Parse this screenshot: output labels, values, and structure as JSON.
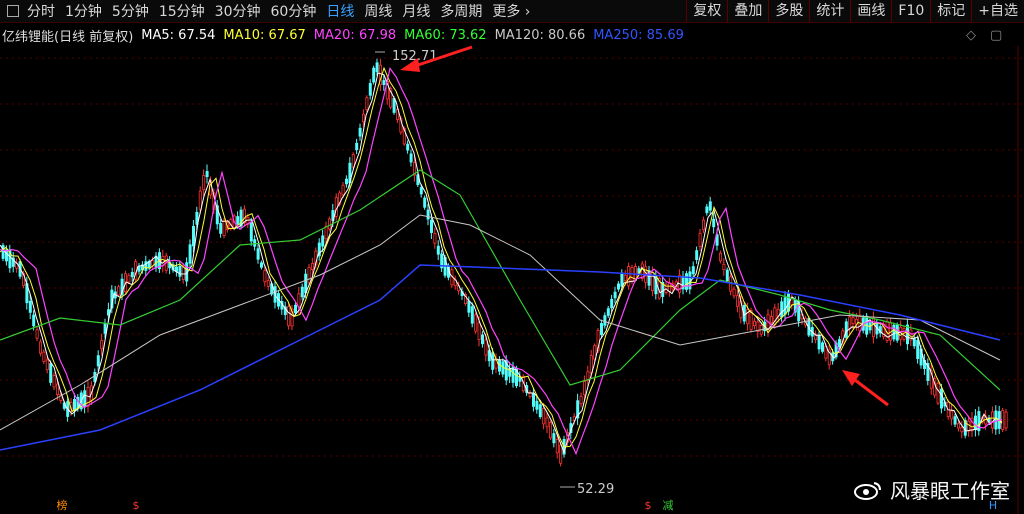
{
  "toolbar": {
    "periods": [
      {
        "label": "分时",
        "active": false
      },
      {
        "label": "1分钟",
        "active": false
      },
      {
        "label": "5分钟",
        "active": false
      },
      {
        "label": "15分钟",
        "active": false
      },
      {
        "label": "30分钟",
        "active": false
      },
      {
        "label": "60分钟",
        "active": false
      },
      {
        "label": "日线",
        "active": true
      },
      {
        "label": "周线",
        "active": false
      },
      {
        "label": "月线",
        "active": false
      },
      {
        "label": "多周期",
        "active": false
      },
      {
        "label": "更多",
        "active": false
      }
    ],
    "more_arrow": "›",
    "right": [
      "复权",
      "叠加",
      "多股",
      "统计",
      "画线",
      "F10",
      "标记",
      "+自选"
    ]
  },
  "header": {
    "title": "亿纬锂能(日线 前复权)",
    "ma": [
      {
        "label": "MA5: 67.54",
        "color": "#ffffff"
      },
      {
        "label": "MA10: 67.67",
        "color": "#ffff33"
      },
      {
        "label": "MA20: 67.98",
        "color": "#ff44ff"
      },
      {
        "label": "MA60: 73.62",
        "color": "#33ff33"
      },
      {
        "label": "MA120: 80.66",
        "color": "#c8c8c8"
      },
      {
        "label": "MA250: 85.69",
        "color": "#3355ff"
      }
    ],
    "controls": [
      "◇",
      "▢"
    ]
  },
  "chart": {
    "high_label": "152.71",
    "low_label": "52.29"
  },
  "markers": [
    {
      "text": "榜",
      "color": "#ff8800"
    },
    {
      "text": "$",
      "color": "#ff3333"
    },
    {
      "text": "$",
      "color": "#ff3333"
    },
    {
      "text": "减",
      "color": "#33cc33"
    },
    {
      "text": "H",
      "color": "#3399ff"
    }
  ],
  "watermark": "风暴眼工作室"
}
